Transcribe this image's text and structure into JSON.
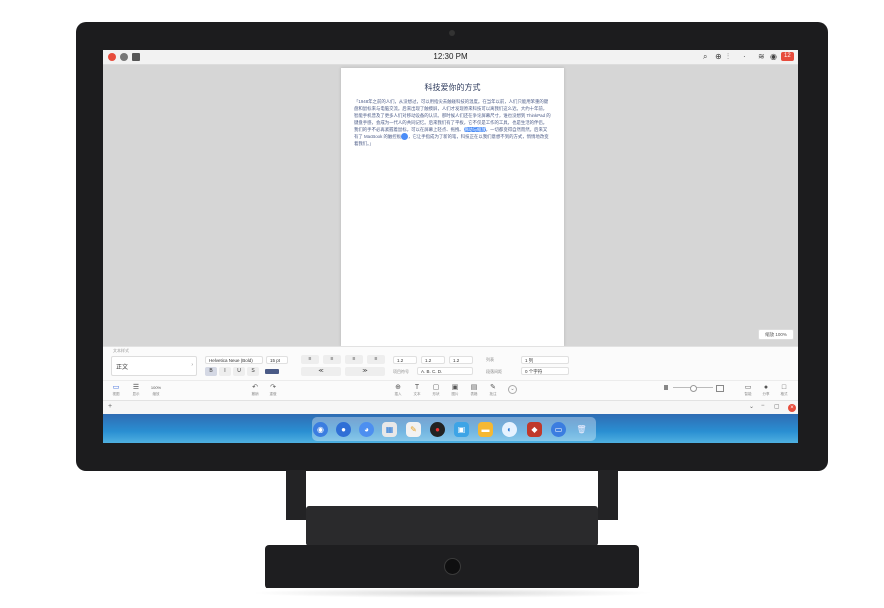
{
  "menubar": {
    "time": "12:30 PM",
    "badge": "12"
  },
  "document": {
    "title": "科技爱你的方式",
    "para_before": "「1948年之前的人们，从没想过，可以用指尖去触碰科技的温度。在当年以前，人们只能用笨重的键盘和鼠标来与电脑交流。后来出现了触摸屏，人们才发现原来科技可以离我们这么近。大约十年前，智能手机普及了更多人们对移动设备的认识。那时候人们还在争论屏幕尺寸，谁也没想到 ThinkPad 的键盘手感，会成为一代人的共同记忆。后来我们有了平板，它不仅是工作的工具，也是生活的伴侣。我们的手不必再紧握着鼠标，可以在屏幕上轻点、拖拽、",
    "highlight": "滑动与缩放",
    "para_middle": "，一切都变得自然而然。后来又有了 MacBook 的触控板",
    "para_after": "，它让手指成为了新的笔，科技正在以我们意想不到的方式，悄悄地改变着我们。」"
  },
  "zoom_label": "缩放 100%",
  "format": {
    "caption": "文本样式",
    "style": "正文",
    "font": "Helvetica Neue (Bold)",
    "size": "15 pt",
    "spacing": [
      "1.2",
      "1.2",
      "1.2"
    ],
    "list_label": "列表",
    "list_value": "1 列",
    "numbering_label": "项目符号",
    "numbering_value": "A. B. C. D.",
    "indent_label": "段落间距",
    "indent_value": "0 个字符",
    "buttons": {
      "bold": "B",
      "italic": "I",
      "underline": "U",
      "strike": "S",
      "indent_less": "≪",
      "indent_more": "≫"
    }
  },
  "toolbar": {
    "left": [
      {
        "label": "视图",
        "icon": "▭"
      },
      {
        "label": "显示",
        "icon": "☰"
      },
      {
        "label": "缩放",
        "icon": "100%"
      }
    ],
    "undo": [
      {
        "label": "撤销",
        "icon": "↶"
      },
      {
        "label": "重做",
        "icon": "↷"
      }
    ],
    "center": [
      {
        "label": "插入",
        "icon": "⊕"
      },
      {
        "label": "文本",
        "icon": "T"
      },
      {
        "label": "形状",
        "icon": "▢"
      },
      {
        "label": "图片",
        "icon": "▣"
      },
      {
        "label": "表格",
        "icon": "▤"
      },
      {
        "label": "批注",
        "icon": "✎"
      }
    ],
    "right": [
      {
        "label": "智能",
        "icon": "▭"
      },
      {
        "label": "分享",
        "icon": "●"
      },
      {
        "label": "格式",
        "icon": "□"
      },
      {
        "label": "文稿",
        "icon": "▯"
      }
    ]
  },
  "dock_icons": [
    "finder-icon",
    "mail-icon",
    "messages-icon",
    "photos-icon",
    "notes-icon",
    "music-icon",
    "gallery-icon",
    "folder-icon",
    "safari-icon",
    "books-icon",
    "app-store-icon",
    "trash-icon"
  ]
}
